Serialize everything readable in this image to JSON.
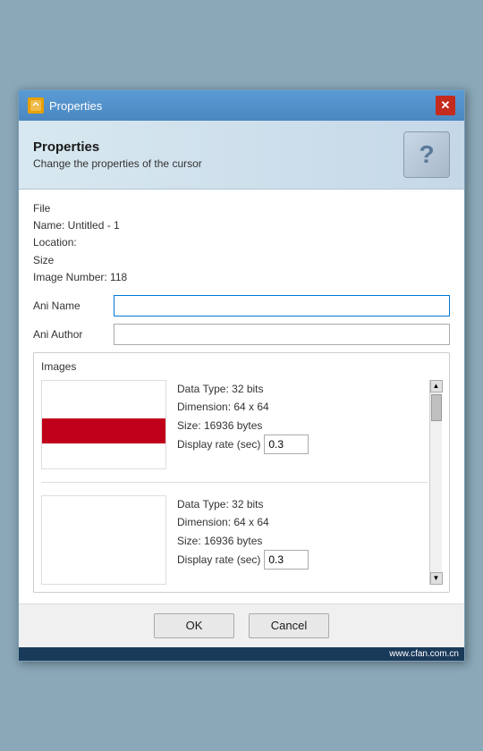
{
  "titlebar": {
    "title": "Properties",
    "close_label": "✕"
  },
  "header": {
    "title": "Properties",
    "subtitle": "Change the properties of the cursor",
    "help_icon": "?"
  },
  "file_info": {
    "file_label": "File",
    "name_label": "Name: Untitled - 1",
    "location_label": "Location:",
    "size_label": "Size",
    "image_number_label": "Image Number: 118"
  },
  "fields": {
    "ani_name_label": "Ani Name",
    "ani_name_value": "",
    "ani_name_placeholder": "",
    "ani_author_label": "Ani Author",
    "ani_author_value": "",
    "ani_author_placeholder": ""
  },
  "images": {
    "section_label": "Images",
    "items": [
      {
        "data_type": "Data Type: 32 bits",
        "dimension": "Dimension: 64 x 64",
        "size": "Size: 16936 bytes",
        "display_rate_label": "Display rate (sec)",
        "display_rate_value": "0.3"
      },
      {
        "data_type": "Data Type: 32 bits",
        "dimension": "Dimension: 64 x 64",
        "size": "Size: 16936 bytes",
        "display_rate_label": "Display rate (sec)",
        "display_rate_value": "0.3"
      }
    ]
  },
  "footer": {
    "ok_label": "OK",
    "cancel_label": "Cancel"
  },
  "watermark": "www.cfan.com.cn"
}
